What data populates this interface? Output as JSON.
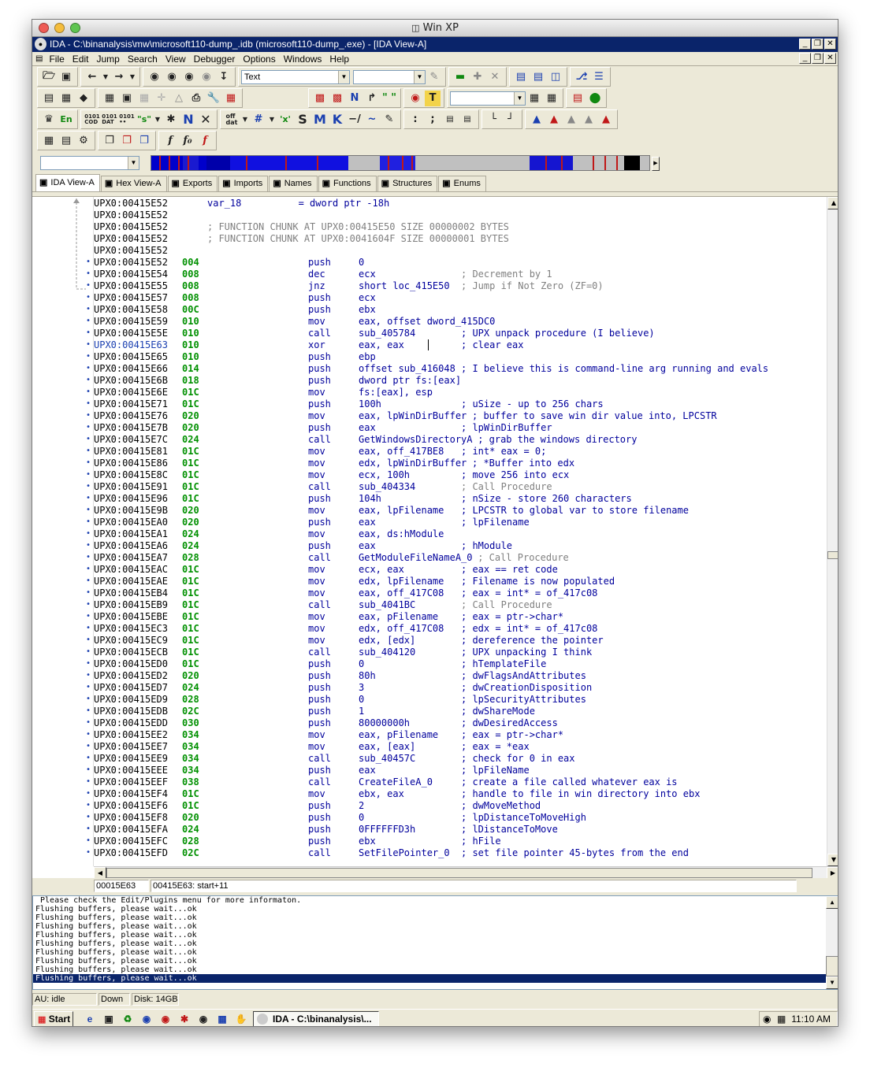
{
  "outer_window": {
    "title": "Win XP"
  },
  "ida_window": {
    "title": "IDA - C:\\binanalysis\\mw\\microsoft110-dump_.idb (microsoft110-dump_.exe) - [IDA View-A]"
  },
  "menu": [
    "File",
    "Edit",
    "Jump",
    "Search",
    "View",
    "Debugger",
    "Options",
    "Windows",
    "Help"
  ],
  "toolbar": {
    "segment_combo_value": "Text"
  },
  "tabs": [
    {
      "label": "IDA View-A",
      "icon": "ida-view-icon"
    },
    {
      "label": "Hex View-A",
      "icon": "hex-view-icon"
    },
    {
      "label": "Exports",
      "icon": "exports-icon"
    },
    {
      "label": "Imports",
      "icon": "imports-icon"
    },
    {
      "label": "Names",
      "icon": "names-icon"
    },
    {
      "label": "Functions",
      "icon": "functions-icon"
    },
    {
      "label": "Structures",
      "icon": "structures-icon"
    },
    {
      "label": "Enums",
      "icon": "enums-icon"
    }
  ],
  "header_lines": [
    {
      "addr": "UPX0:00415E52",
      "text": "var_18          = dword ptr -18h",
      "grey": false,
      "stacktext": true
    },
    {
      "addr": "UPX0:00415E52",
      "text": "",
      "grey": false
    },
    {
      "addr": "UPX0:00415E52",
      "text": "; FUNCTION CHUNK AT UPX0:00415E50 SIZE 00000002 BYTES",
      "grey": true
    },
    {
      "addr": "UPX0:00415E52",
      "text": "; FUNCTION CHUNK AT UPX0:0041604F SIZE 00000001 BYTES",
      "grey": true
    },
    {
      "addr": "UPX0:00415E52",
      "text": "",
      "grey": false
    }
  ],
  "instructions": [
    {
      "addr": "UPX0:00415E52",
      "sp": "004",
      "mn": "push",
      "op": "0",
      "cm": ""
    },
    {
      "addr": "UPX0:00415E54",
      "sp": "008",
      "mn": "dec",
      "op": "ecx",
      "cm": "; Decrement by 1",
      "grey": true
    },
    {
      "addr": "UPX0:00415E55",
      "sp": "008",
      "mn": "jnz",
      "op": "short loc_415E50",
      "cm": "; Jump if Not Zero (ZF=0)",
      "grey": true
    },
    {
      "addr": "UPX0:00415E57",
      "sp": "008",
      "mn": "push",
      "op": "ecx",
      "cm": ""
    },
    {
      "addr": "UPX0:00415E58",
      "sp": "00C",
      "mn": "push",
      "op": "ebx",
      "cm": ""
    },
    {
      "addr": "UPX0:00415E59",
      "sp": "010",
      "mn": "mov",
      "op": "eax, offset dword_415DC0",
      "cm": ""
    },
    {
      "addr": "UPX0:00415E5E",
      "sp": "010",
      "mn": "call",
      "op": "sub_405784",
      "cm": "; UPX unpack procedure (I believe)"
    },
    {
      "addr": "UPX0:00415E63",
      "sp": "010",
      "mn": "xor",
      "op": "eax, eax",
      "cm": "; clear eax",
      "current": true
    },
    {
      "addr": "UPX0:00415E65",
      "sp": "010",
      "mn": "push",
      "op": "ebp",
      "cm": ""
    },
    {
      "addr": "UPX0:00415E66",
      "sp": "014",
      "mn": "push",
      "op": "offset sub_416048",
      "cm": "; I believe this is command-line arg running and evals",
      "inline": true
    },
    {
      "addr": "UPX0:00415E6B",
      "sp": "018",
      "mn": "push",
      "op": "dword ptr fs:[eax]",
      "cm": ""
    },
    {
      "addr": "UPX0:00415E6E",
      "sp": "01C",
      "mn": "mov",
      "op": "fs:[eax], esp",
      "cm": ""
    },
    {
      "addr": "UPX0:00415E71",
      "sp": "01C",
      "mn": "push",
      "op": "100h",
      "cm": "; uSize - up to 256 chars"
    },
    {
      "addr": "UPX0:00415E76",
      "sp": "020",
      "mn": "mov",
      "op": "eax, lpWinDirBuffer",
      "cm": "; buffer to save win dir value into, LPCSTR",
      "inline": true
    },
    {
      "addr": "UPX0:00415E7B",
      "sp": "020",
      "mn": "push",
      "op": "eax",
      "cm": "; lpWinDirBuffer"
    },
    {
      "addr": "UPX0:00415E7C",
      "sp": "024",
      "mn": "call",
      "op": "GetWindowsDirectoryA",
      "cm": "; grab the windows directory",
      "inline": true
    },
    {
      "addr": "UPX0:00415E81",
      "sp": "01C",
      "mn": "mov",
      "op": "eax, off_417BE8",
      "cm": "; int* eax = 0;"
    },
    {
      "addr": "UPX0:00415E86",
      "sp": "01C",
      "mn": "mov",
      "op": "edx, lpWinDirBuffer",
      "cm": "; *Buffer into edx",
      "inline": true
    },
    {
      "addr": "UPX0:00415E8C",
      "sp": "01C",
      "mn": "mov",
      "op": "ecx, 100h",
      "cm": "; move 256 into ecx"
    },
    {
      "addr": "UPX0:00415E91",
      "sp": "01C",
      "mn": "call",
      "op": "sub_404334",
      "cm": "; Call Procedure",
      "grey": true
    },
    {
      "addr": "UPX0:00415E96",
      "sp": "01C",
      "mn": "push",
      "op": "104h",
      "cm": "; nSize - store 260 characters"
    },
    {
      "addr": "UPX0:00415E9B",
      "sp": "020",
      "mn": "mov",
      "op": "eax, lpFilename",
      "cm": "; LPCSTR to global var to store filename"
    },
    {
      "addr": "UPX0:00415EA0",
      "sp": "020",
      "mn": "push",
      "op": "eax",
      "cm": "; lpFilename"
    },
    {
      "addr": "UPX0:00415EA1",
      "sp": "024",
      "mn": "mov",
      "op": "eax, ds:hModule",
      "cm": ""
    },
    {
      "addr": "UPX0:00415EA6",
      "sp": "024",
      "mn": "push",
      "op": "eax",
      "cm": "; hModule"
    },
    {
      "addr": "UPX0:00415EA7",
      "sp": "028",
      "mn": "call",
      "op": "GetModuleFileNameA_0",
      "cm": "; Call Procedure",
      "grey": true,
      "inline": true
    },
    {
      "addr": "UPX0:00415EAC",
      "sp": "01C",
      "mn": "mov",
      "op": "ecx, eax",
      "cm": "; eax == ret code"
    },
    {
      "addr": "UPX0:00415EAE",
      "sp": "01C",
      "mn": "mov",
      "op": "edx, lpFilename",
      "cm": "; Filename is now populated"
    },
    {
      "addr": "UPX0:00415EB4",
      "sp": "01C",
      "mn": "mov",
      "op": "eax, off_417C08",
      "cm": "; eax = int* = of_417c08"
    },
    {
      "addr": "UPX0:00415EB9",
      "sp": "01C",
      "mn": "call",
      "op": "sub_4041BC",
      "cm": "; Call Procedure",
      "grey": true
    },
    {
      "addr": "UPX0:00415EBE",
      "sp": "01C",
      "mn": "mov",
      "op": "eax, pFilename",
      "cm": "; eax = ptr->char*"
    },
    {
      "addr": "UPX0:00415EC3",
      "sp": "01C",
      "mn": "mov",
      "op": "edx, off_417C08",
      "cm": "; edx = int* = of_417c08"
    },
    {
      "addr": "UPX0:00415EC9",
      "sp": "01C",
      "mn": "mov",
      "op": "edx, [edx]",
      "cm": "; dereference the pointer"
    },
    {
      "addr": "UPX0:00415ECB",
      "sp": "01C",
      "mn": "call",
      "op": "sub_404120",
      "cm": "; UPX unpacking I think"
    },
    {
      "addr": "UPX0:00415ED0",
      "sp": "01C",
      "mn": "push",
      "op": "0",
      "cm": "; hTemplateFile"
    },
    {
      "addr": "UPX0:00415ED2",
      "sp": "020",
      "mn": "push",
      "op": "80h",
      "cm": "; dwFlagsAndAttributes"
    },
    {
      "addr": "UPX0:00415ED7",
      "sp": "024",
      "mn": "push",
      "op": "3",
      "cm": "; dwCreationDisposition"
    },
    {
      "addr": "UPX0:00415ED9",
      "sp": "028",
      "mn": "push",
      "op": "0",
      "cm": "; lpSecurityAttributes"
    },
    {
      "addr": "UPX0:00415EDB",
      "sp": "02C",
      "mn": "push",
      "op": "1",
      "cm": "; dwShareMode"
    },
    {
      "addr": "UPX0:00415EDD",
      "sp": "030",
      "mn": "push",
      "op": "80000000h",
      "cm": "; dwDesiredAccess"
    },
    {
      "addr": "UPX0:00415EE2",
      "sp": "034",
      "mn": "mov",
      "op": "eax, pFilename",
      "cm": "; eax = ptr->char*"
    },
    {
      "addr": "UPX0:00415EE7",
      "sp": "034",
      "mn": "mov",
      "op": "eax, [eax]",
      "cm": "; eax = *eax"
    },
    {
      "addr": "UPX0:00415EE9",
      "sp": "034",
      "mn": "call",
      "op": "sub_40457C",
      "cm": "; check for 0 in eax"
    },
    {
      "addr": "UPX0:00415EEE",
      "sp": "034",
      "mn": "push",
      "op": "eax",
      "cm": "; lpFileName"
    },
    {
      "addr": "UPX0:00415EEF",
      "sp": "038",
      "mn": "call",
      "op": "CreateFileA_0",
      "cm": "; create a file called whatever eax is"
    },
    {
      "addr": "UPX0:00415EF4",
      "sp": "01C",
      "mn": "mov",
      "op": "ebx, eax",
      "cm": "; handle to file in win directory into ebx"
    },
    {
      "addr": "UPX0:00415EF6",
      "sp": "01C",
      "mn": "push",
      "op": "2",
      "cm": "; dwMoveMethod"
    },
    {
      "addr": "UPX0:00415EF8",
      "sp": "020",
      "mn": "push",
      "op": "0",
      "cm": "; lpDistanceToMoveHigh"
    },
    {
      "addr": "UPX0:00415EFA",
      "sp": "024",
      "mn": "push",
      "op": "0FFFFFFD3h",
      "cm": "; lDistanceToMove"
    },
    {
      "addr": "UPX0:00415EFC",
      "sp": "028",
      "mn": "push",
      "op": "ebx",
      "cm": "; hFile"
    },
    {
      "addr": "UPX0:00415EFD",
      "sp": "02C",
      "mn": "call",
      "op": "SetFilePointer_0",
      "cm": "; set file pointer 45-bytes from the end",
      "inline": true
    }
  ],
  "status": {
    "file_offset": "00015E63",
    "location": "00415E63: start+11"
  },
  "output_lines": [
    " Please check the Edit/Plugins menu for more informaton.",
    "Flushing buffers, please wait...ok",
    "Flushing buffers, please wait...ok",
    "Flushing buffers, please wait...ok",
    "Flushing buffers, please wait...ok",
    "Flushing buffers, please wait...ok",
    "Flushing buffers, please wait...ok",
    "Flushing buffers, please wait...ok",
    "Flushing buffers, please wait...ok",
    "Flushing buffers, please wait...ok"
  ],
  "bottom_status": {
    "au": "AU: idle",
    "direction": "Down",
    "disk": "Disk: 14GB"
  },
  "taskbar": {
    "start": "Start",
    "task": "IDA - C:\\binanalysis\\...",
    "clock": "11:10 AM"
  },
  "colors": {
    "title_bar": "#0a246a",
    "code_blue": "#00009c",
    "stack_green": "#009000",
    "comment_grey": "#808080"
  }
}
